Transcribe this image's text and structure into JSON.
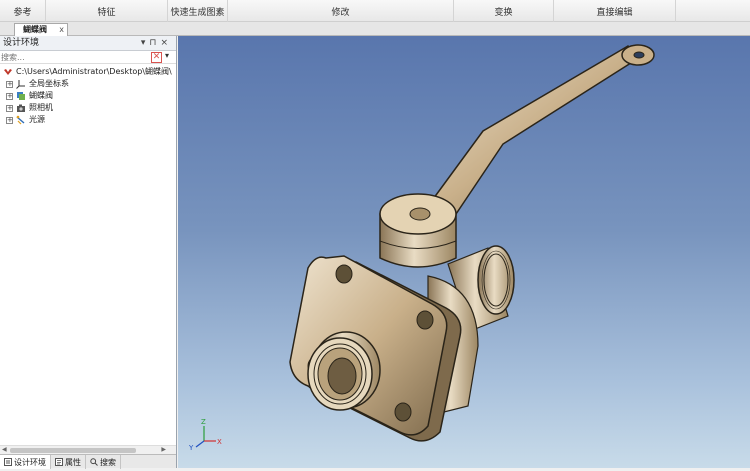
{
  "ribbon": {
    "groups": [
      "参考",
      "特征",
      "快速生成图素",
      "修改",
      "变换",
      "直接编辑"
    ]
  },
  "document_tab": {
    "label": "蝴蝶阀",
    "close": "x"
  },
  "panel": {
    "title": "设计环境",
    "controls": [
      "▾",
      "⊓",
      "×"
    ],
    "search_placeholder": "搜索...",
    "clear_symbol": "✕",
    "options_symbol": "▾",
    "tree": {
      "root": "C:\\Users\\Administrator\\Desktop\\蝴蝶阀\\",
      "items": [
        "全局坐标系",
        "蝴蝶阀",
        "照相机",
        "光源"
      ]
    },
    "bottom_tabs": [
      "设计环境",
      "属性",
      "搜索"
    ]
  },
  "viewport": {
    "axis_labels": {
      "x": "X",
      "y": "Y",
      "z": "Z"
    },
    "colors": {
      "bg_top": "#5976ad",
      "bg_bottom": "#c8dbe9",
      "part": "#c9b08a"
    }
  }
}
